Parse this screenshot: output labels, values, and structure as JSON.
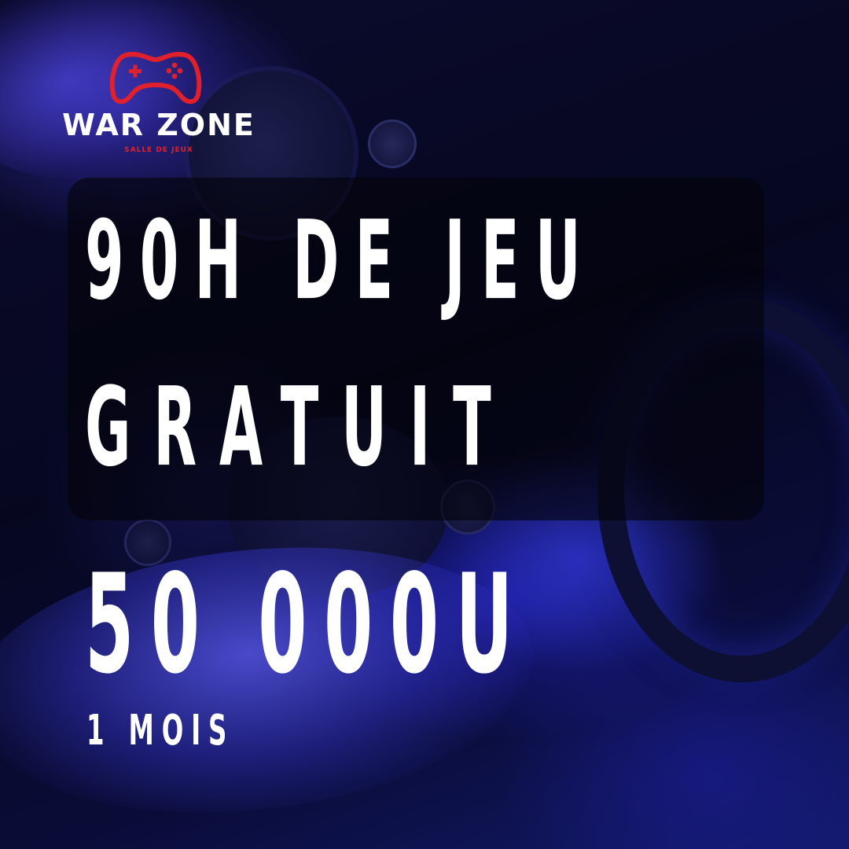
{
  "brand": {
    "name": "WAR ZONE",
    "tagline": "SALLE DE JEUX",
    "logo_icon": "gamepad-icon",
    "accent_color": "#e0202a"
  },
  "offer": {
    "line1": "90H DE JEU",
    "line2": "GRATUIT",
    "price": "50 000U",
    "duration": "1 MOIS"
  },
  "colors": {
    "text": "#ffffff",
    "background": "#0a0c38",
    "panel": "rgba(3,3,10,0.62)"
  }
}
